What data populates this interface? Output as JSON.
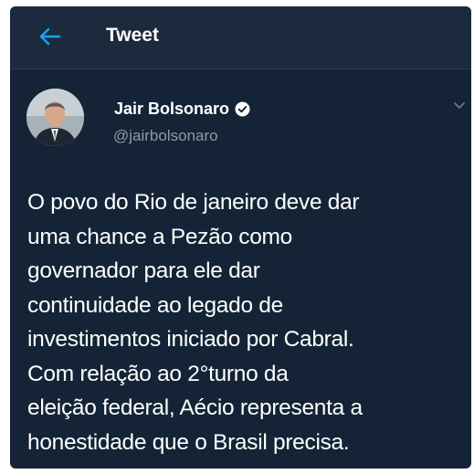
{
  "header": {
    "title": "Tweet",
    "back_icon": "arrow-left-icon"
  },
  "tweet": {
    "author_name": "Jair Bolsonaro",
    "author_handle": "@jairbolsonaro",
    "verified_icon": "verified-badge-icon",
    "menu_icon": "chevron-down-icon",
    "text_lines": [
      "O povo do Rio de janeiro deve dar",
      "uma chance a Pezão como",
      "governador para ele dar",
      "continuidade ao legado de",
      "investimentos iniciado por Cabral.",
      "Com relação ao 2°turno da",
      "eleição federal, Aécio representa a",
      "honestidade que o Brasil precisa."
    ]
  },
  "colors": {
    "background": "#142436",
    "header": "#1b2b3d",
    "accent": "#1da1f2",
    "text_primary": "#ffffff",
    "text_secondary": "#8d9aa7"
  }
}
